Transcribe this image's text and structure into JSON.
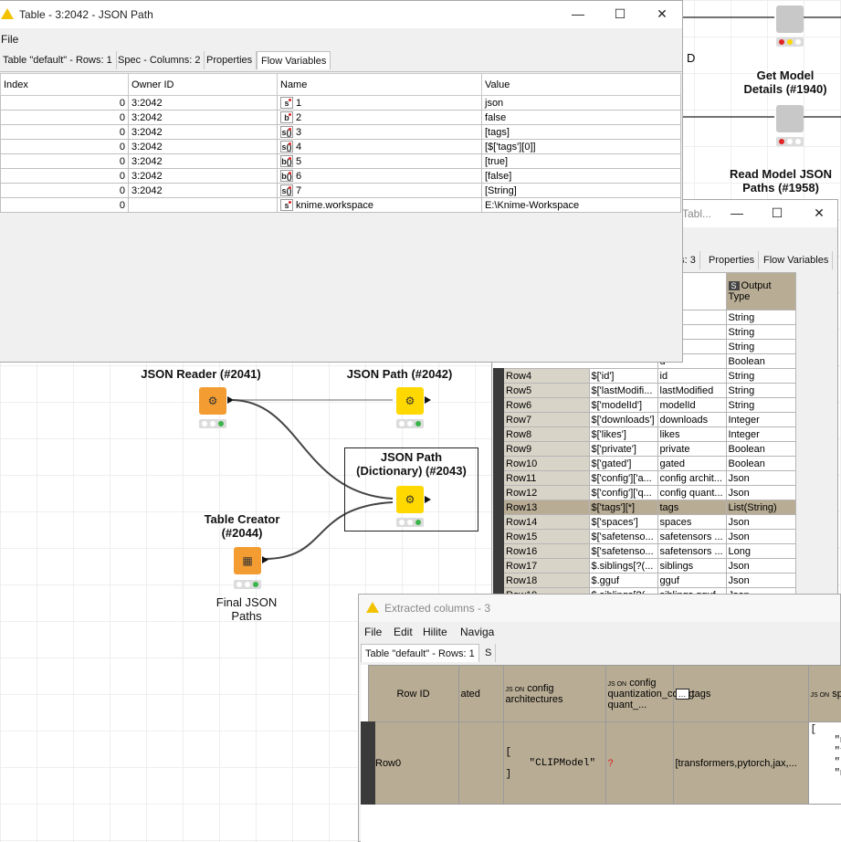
{
  "workflow": {
    "nodes": {
      "get_model_details": {
        "label_line1": "Get Model",
        "label_line2": "Details (#1940)"
      },
      "read_model_json_paths": {
        "label_line1": "Read Model JSON",
        "label_line2": "Paths (#1958)"
      },
      "json_reader": {
        "label": "JSON Reader (#2041)"
      },
      "json_path": {
        "label": "JSON Path (#2042)"
      },
      "json_path_dict": {
        "label_line1": "JSON Path",
        "label_line2": "(Dictionary) (#2043)"
      },
      "table_creator": {
        "label_line1": "Table Creator",
        "label_line2": "(#2044)",
        "sub_line1": "Final JSON",
        "sub_line2": "Paths"
      }
    },
    "bg_fragment": "D"
  },
  "flow_window": {
    "title": "Table - 3:2042 - JSON Path",
    "menu": "File",
    "tabs": [
      "Table \"default\" - Rows: 1",
      "Spec - Columns: 2",
      "Properties",
      "Flow Variables"
    ],
    "columns": [
      "Index",
      "Owner ID",
      "Name",
      "Value"
    ],
    "rows": [
      {
        "index": "0",
        "owner": "3:2042",
        "type": "s",
        "name": "1",
        "value": "json"
      },
      {
        "index": "0",
        "owner": "3:2042",
        "type": "b",
        "name": "2",
        "value": "false"
      },
      {
        "index": "0",
        "owner": "3:2042",
        "type": "s()",
        "name": "3",
        "value": "[tags]"
      },
      {
        "index": "0",
        "owner": "3:2042",
        "type": "s()",
        "name": "4",
        "value": "[$['tags'][0]]"
      },
      {
        "index": "0",
        "owner": "3:2042",
        "type": "b()",
        "name": "5",
        "value": "[true]"
      },
      {
        "index": "0",
        "owner": "3:2042",
        "type": "b()",
        "name": "6",
        "value": "[false]"
      },
      {
        "index": "0",
        "owner": "3:2042",
        "type": "s()",
        "name": "7",
        "value": "[String]"
      },
      {
        "index": "0",
        "owner": "",
        "type": "s",
        "name": "knime.workspace",
        "value": "E:\\Knime-Workspace"
      }
    ]
  },
  "spec_window": {
    "title_fragment": "Tabl...",
    "tabs": [
      "ns: 3",
      "Properties",
      "Flow Variables"
    ],
    "col_name_header": "ame",
    "col_type_header": "Output Type",
    "type_icon": "S",
    "top_rows": [
      {
        "name": "",
        "type": "String"
      },
      {
        "name": "",
        "type": "String"
      },
      {
        "name": "dAt",
        "type": "String"
      },
      {
        "name": "d",
        "type": "Boolean"
      }
    ],
    "rows": [
      {
        "id": "Row4",
        "path": "$['id']",
        "name": "id",
        "type": "String"
      },
      {
        "id": "Row5",
        "path": "$['lastModifi...",
        "name": "lastModified",
        "type": "String"
      },
      {
        "id": "Row6",
        "path": "$['modelId']",
        "name": "modelId",
        "type": "String"
      },
      {
        "id": "Row7",
        "path": "$['downloads']",
        "name": "downloads",
        "type": "Integer"
      },
      {
        "id": "Row8",
        "path": "$['likes']",
        "name": "likes",
        "type": "Integer"
      },
      {
        "id": "Row9",
        "path": "$['private']",
        "name": "private",
        "type": "Boolean"
      },
      {
        "id": "Row10",
        "path": "$['gated']",
        "name": "gated",
        "type": "Boolean"
      },
      {
        "id": "Row11",
        "path": "$['config']['a...",
        "name": "config archit...",
        "type": "Json"
      },
      {
        "id": "Row12",
        "path": "$['config']['q...",
        "name": "config quant...",
        "type": "Json"
      },
      {
        "id": "Row13",
        "path": "$['tags'][*]",
        "name": "tags",
        "type": "List(String)"
      },
      {
        "id": "Row14",
        "path": "$['spaces']",
        "name": "spaces",
        "type": "Json"
      },
      {
        "id": "Row15",
        "path": "$['safetenso...",
        "name": "safetensors ...",
        "type": "Json"
      },
      {
        "id": "Row16",
        "path": "$['safetenso...",
        "name": "safetensors ...",
        "type": "Long"
      },
      {
        "id": "Row17",
        "path": "$.siblings[?(...",
        "name": "siblings",
        "type": "Json"
      },
      {
        "id": "Row18",
        "path": "$.gguf",
        "name": "gguf",
        "type": "Json"
      },
      {
        "id": "Row19",
        "path": "$.siblings[?(...",
        "name": "siblings gguf",
        "type": "Json"
      }
    ],
    "selected_row": "Row13"
  },
  "extract_window": {
    "title": "Extracted columns - 3",
    "menu": [
      "File",
      "Edit",
      "Hilite",
      "Naviga"
    ],
    "tabs": [
      "Table \"default\" - Rows: 1",
      "S"
    ],
    "json_badge": "JS ON",
    "headers": {
      "row_id": "Row ID",
      "gated": "ated",
      "config_arch": "config architectures",
      "config_quant": "config quantization_config quant_...",
      "tags": "tags",
      "spaces": "spac"
    },
    "row": {
      "id": "Row0",
      "bracket_open": "[",
      "bracket_close": "]",
      "config_arch_value": "\"CLIPModel\"",
      "config_quant_value": "?",
      "tags_value": "[transformers,pytorch,jax,...",
      "spaces_lines": [
        "[",
        "\"m",
        "\"v",
        "\"t",
        "\"m"
      ]
    }
  },
  "colors": {
    "node_orange": "#f39c32",
    "node_yellow": "#ffd800",
    "table_header_tan": "#b8ac94",
    "selected_row": "#b8ac94"
  }
}
